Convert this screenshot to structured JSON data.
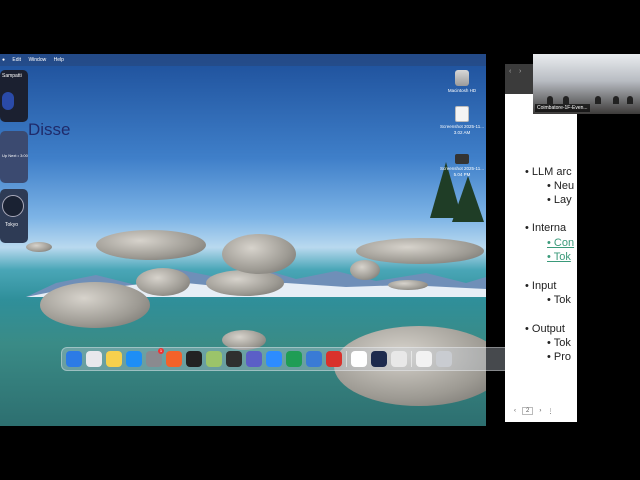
{
  "menubar": {
    "items": [
      "Edit",
      "Window",
      "Help"
    ]
  },
  "widgets": {
    "calendar_label": "Sampatti",
    "middle_label": "Up Next • 3:00",
    "clock_label": "Tokyo"
  },
  "desktop_icons": [
    {
      "label": "Macintosh HD"
    },
    {
      "label": "Screenshot 2025-11... 3.02 AM"
    },
    {
      "label": "Screenshot 2025-11... 5.04 PM"
    }
  ],
  "dock": {
    "apps": [
      {
        "name": "finder-icon",
        "color": "#2c7be5"
      },
      {
        "name": "launchpad-icon",
        "color": "#e8e8ec"
      },
      {
        "name": "notes-icon",
        "color": "#f6d04d"
      },
      {
        "name": "app-store-icon",
        "color": "#1e8ef5"
      },
      {
        "name": "settings-icon",
        "color": "#8a8a8f",
        "badge": "1"
      },
      {
        "name": "brave-icon",
        "color": "#f3622a"
      },
      {
        "name": "terminal-icon",
        "color": "#222222"
      },
      {
        "name": "preview-icon",
        "color": "#9bc46a"
      },
      {
        "name": "cursor-icon",
        "color": "#2f2f2f"
      },
      {
        "name": "teams-icon",
        "color": "#5b5fc7"
      },
      {
        "name": "zoom-icon",
        "color": "#2d8cff"
      },
      {
        "name": "excel-icon",
        "color": "#1f9d55"
      },
      {
        "name": "vpn-icon",
        "color": "#3a7bd5"
      },
      {
        "name": "acrobat-icon",
        "color": "#d9312b"
      },
      {
        "name": "chatgpt-icon",
        "color": "#ffffff"
      },
      {
        "name": "affinity-icon",
        "color": "#1d2a4d"
      },
      {
        "name": "chrome-icon",
        "color": "#e8e8e8"
      },
      {
        "name": "document-icon",
        "color": "#f2f2f2"
      },
      {
        "name": "trash-icon",
        "color": "#c9ccd1"
      }
    ]
  },
  "slide": {
    "title": "Disse",
    "lines": [
      {
        "text": "• LLM arc",
        "indent": 0
      },
      {
        "text": "• Neu",
        "indent": 1
      },
      {
        "text": "• Lay",
        "indent": 1
      },
      {
        "text": "• Interna",
        "indent": 0
      },
      {
        "text": "• Con",
        "indent": 1,
        "link": true
      },
      {
        "text": "• Tok",
        "indent": 1,
        "link": true
      },
      {
        "text": "• Input",
        "indent": 0
      },
      {
        "text": "• Tok",
        "indent": 1
      },
      {
        "text": "• Output",
        "indent": 0
      },
      {
        "text": "• Tok",
        "indent": 1
      },
      {
        "text": "• Pro",
        "indent": 1
      }
    ],
    "page": "2"
  },
  "video_tile": {
    "caption": "Coimbatore-1F-Even..."
  }
}
